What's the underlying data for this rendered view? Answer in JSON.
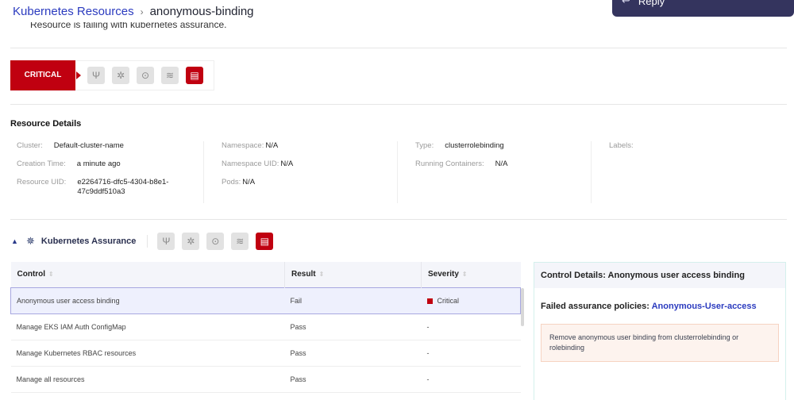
{
  "breadcrumb": {
    "parent": "Kubernetes Resources",
    "separator": "›",
    "current": "anonymous-binding"
  },
  "subtitle": "Resource is failing with kubernetes assurance.",
  "reply": {
    "icon": "reply-icon",
    "label": "Reply"
  },
  "severity": {
    "label": "CRITICAL",
    "color": "#c00010"
  },
  "tool_icons": [
    {
      "name": "vulnerability-icon",
      "glyph": "Ψ",
      "active": false
    },
    {
      "name": "bug-icon",
      "glyph": "✲",
      "active": false
    },
    {
      "name": "compliance-icon",
      "glyph": "⊙",
      "active": false
    },
    {
      "name": "database-icon",
      "glyph": "≋",
      "active": false
    },
    {
      "name": "kubernetes-assurance-icon",
      "glyph": "▤",
      "active": true
    }
  ],
  "resource_details": {
    "title": "Resource Details",
    "columns": [
      [
        {
          "label": "Cluster:",
          "value": "Default-cluster-name"
        },
        {
          "label": "Creation Time:",
          "value": "a minute ago"
        },
        {
          "label": "Resource UID:",
          "value": "e2264716-dfc5-4304-b8e1-47c9ddf510a3"
        }
      ],
      [
        {
          "label": "Namespace:",
          "value": "N/A"
        },
        {
          "label": "Namespace UID:",
          "value": "N/A"
        },
        {
          "label": "Pods:",
          "value": "N/A"
        }
      ],
      [
        {
          "label": "Type:",
          "value": "clusterrolebinding"
        },
        {
          "label": "Running Containers:",
          "value": "N/A"
        }
      ],
      [
        {
          "label": "Labels:",
          "value": ""
        }
      ]
    ]
  },
  "assurance": {
    "title": "Kubernetes Assurance",
    "collapse_icon": "chevron-up-icon",
    "section_icon": "kubernetes-icon"
  },
  "controls_table": {
    "headers": [
      "Control",
      "Result",
      "Severity"
    ],
    "rows": [
      {
        "control": "Anonymous user access binding",
        "result": "Fail",
        "severity": "Critical",
        "selected": true
      },
      {
        "control": "Manage EKS IAM Auth ConfigMap",
        "result": "Pass",
        "severity": "-",
        "selected": false
      },
      {
        "control": "Manage Kubernetes RBAC resources",
        "result": "Pass",
        "severity": "-",
        "selected": false
      },
      {
        "control": "Manage all resources",
        "result": "Pass",
        "severity": "-",
        "selected": false
      }
    ]
  },
  "control_details": {
    "title": "Control Details: Anonymous user access binding",
    "policies_label": "Failed assurance policies:",
    "policy_link": "Anonymous-User-access",
    "remediation": "Remove anonymous user binding from clusterrolebinding or rolebinding"
  }
}
